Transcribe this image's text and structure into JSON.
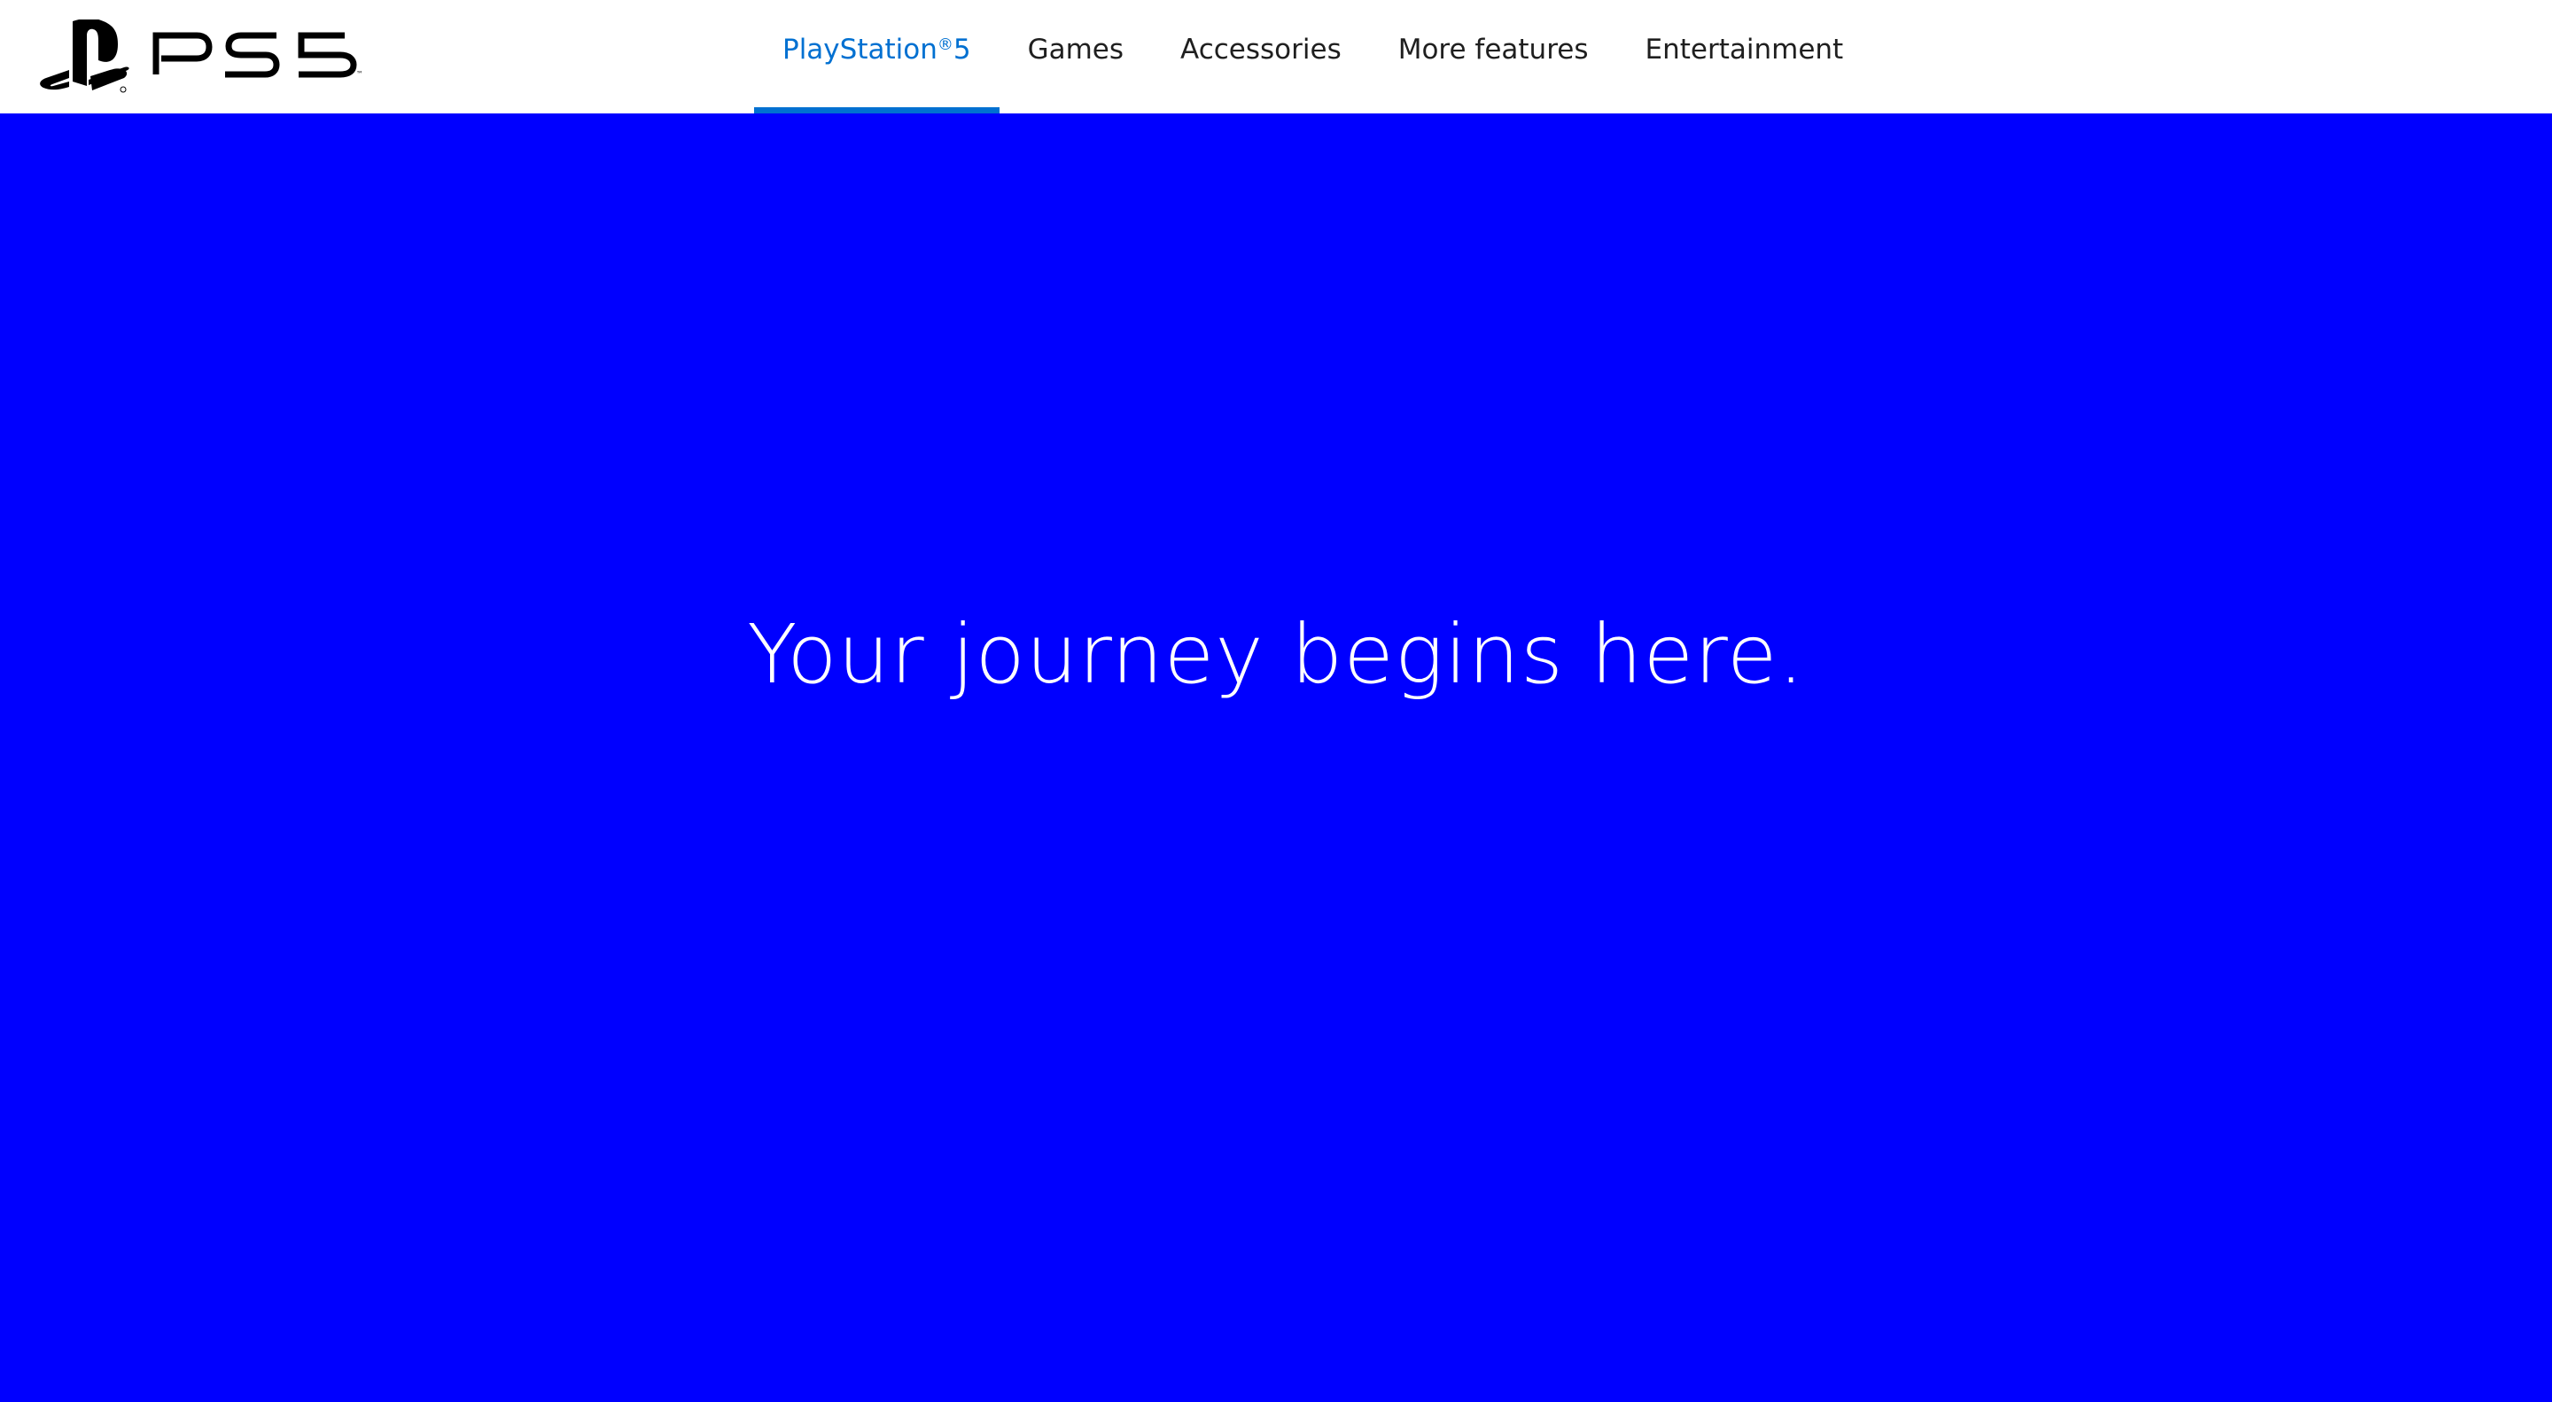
{
  "header": {
    "logo_alt": "PS5",
    "nav": [
      {
        "label": "PlayStation",
        "sup": "®",
        "suffix": "5",
        "active": true
      },
      {
        "label": "Games",
        "active": false
      },
      {
        "label": "Accessories",
        "active": false
      },
      {
        "label": "More features",
        "active": false
      },
      {
        "label": "Entertainment",
        "active": false
      }
    ]
  },
  "hero": {
    "title": "Your journey begins here.",
    "background_color": "#0000ff"
  },
  "colors": {
    "accent": "#0070d1",
    "text": "#1f1f1f"
  }
}
